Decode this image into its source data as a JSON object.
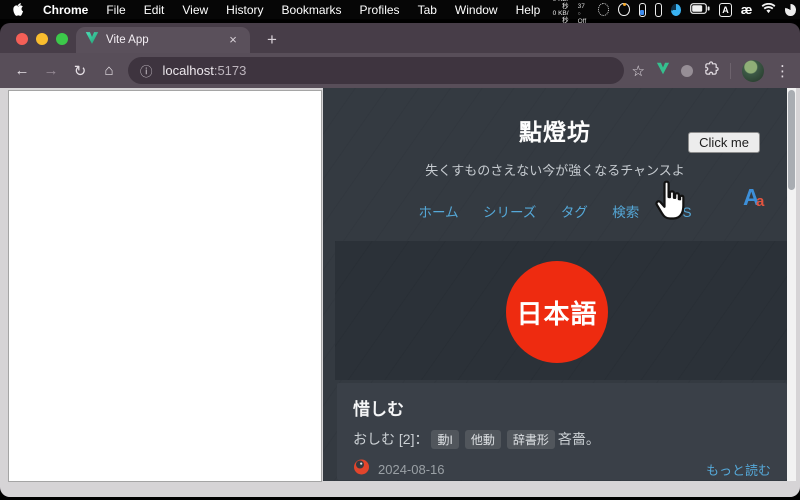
{
  "menubar": {
    "app_name": "Chrome",
    "items": [
      "File",
      "Edit",
      "View",
      "History",
      "Bookmarks",
      "Profiles",
      "Tab",
      "Window",
      "Help"
    ],
    "status": {
      "net_line1": "0 KB/秒",
      "net_line2": "0 KB/秒",
      "gauge_line1": "37",
      "gauge_line2": "Off",
      "input_badge": "A",
      "ae_glyph": "æ"
    }
  },
  "browser": {
    "tab_title": "Vite App",
    "url_host": "localhost",
    "url_port": ":5173",
    "icons": {
      "back": "←",
      "forward": "→",
      "reload": "↻",
      "home": "⌂",
      "site_info": "ⓘ",
      "star": "☆",
      "menu_dots": "⋮",
      "close": "×",
      "new_tab": "+"
    }
  },
  "site": {
    "title": "點燈坊",
    "subtitle": "失くすものさえない今が強くなるチャンスよ",
    "click_me": "Click me",
    "nav": [
      "ホーム",
      "シリーズ",
      "タグ",
      "検索",
      "RSS"
    ],
    "hero_badge": "日本語",
    "font_toggle": {
      "big": "A",
      "small": "a"
    },
    "article": {
      "title": "惜しむ",
      "reading": "おしむ [2]：",
      "tags": [
        "動I",
        "他動",
        "辞書形"
      ],
      "gloss": "吝嗇。",
      "date": "2024-08-16",
      "read_more": "もっと読む"
    },
    "colors": {
      "link_blue": "#55a8d8",
      "hero_red": "#ee2b10"
    }
  }
}
